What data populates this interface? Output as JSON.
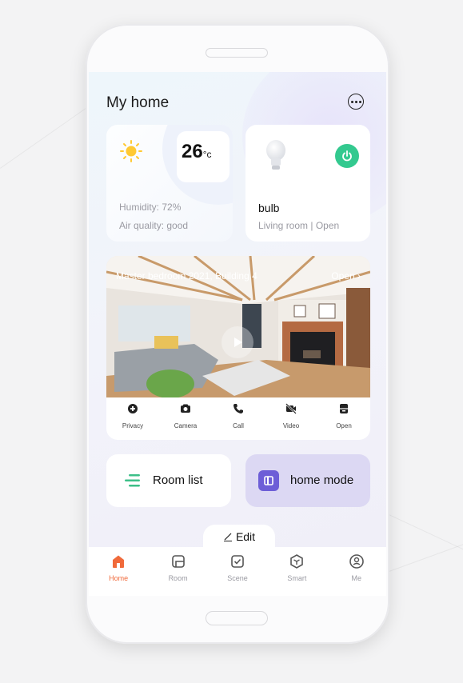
{
  "header": {
    "title": "My home",
    "more_icon": "more-icon"
  },
  "weather": {
    "temperature": "26",
    "unit": "°c",
    "humidity": "Humidity: 72%",
    "air_quality": "Air quality: good",
    "icon": "sun-icon"
  },
  "device": {
    "name": "bulb",
    "status": "Living room | Open",
    "icon": "bulb-icon",
    "power_icon": "power-icon",
    "power_color": "#33c98f"
  },
  "camera": {
    "title": "Master bedroom 2021, Building 4",
    "open_label": "Open",
    "actions": [
      {
        "label": "Privacy",
        "icon": "privacy-icon"
      },
      {
        "label": "Camera",
        "icon": "camera-icon"
      },
      {
        "label": "Call",
        "icon": "call-icon"
      },
      {
        "label": "Video",
        "icon": "video-off-icon"
      },
      {
        "label": "Open",
        "icon": "door-icon"
      }
    ]
  },
  "quick": {
    "room_list_label": "Room list",
    "home_mode_label": "home mode"
  },
  "edit_label": "Edit",
  "tabs": [
    {
      "label": "Home",
      "icon": "home-icon",
      "active": true
    },
    {
      "label": "Room",
      "icon": "room-icon",
      "active": false
    },
    {
      "label": "Scene",
      "icon": "scene-icon",
      "active": false
    },
    {
      "label": "Smart",
      "icon": "smart-icon",
      "active": false
    },
    {
      "label": "Me",
      "icon": "me-icon",
      "active": false
    }
  ],
  "colors": {
    "accent": "#f06a3b",
    "mode_bg": "#dcd8f3",
    "mode_icon": "#6d5ed7",
    "list_icon": "#3cbf88"
  }
}
